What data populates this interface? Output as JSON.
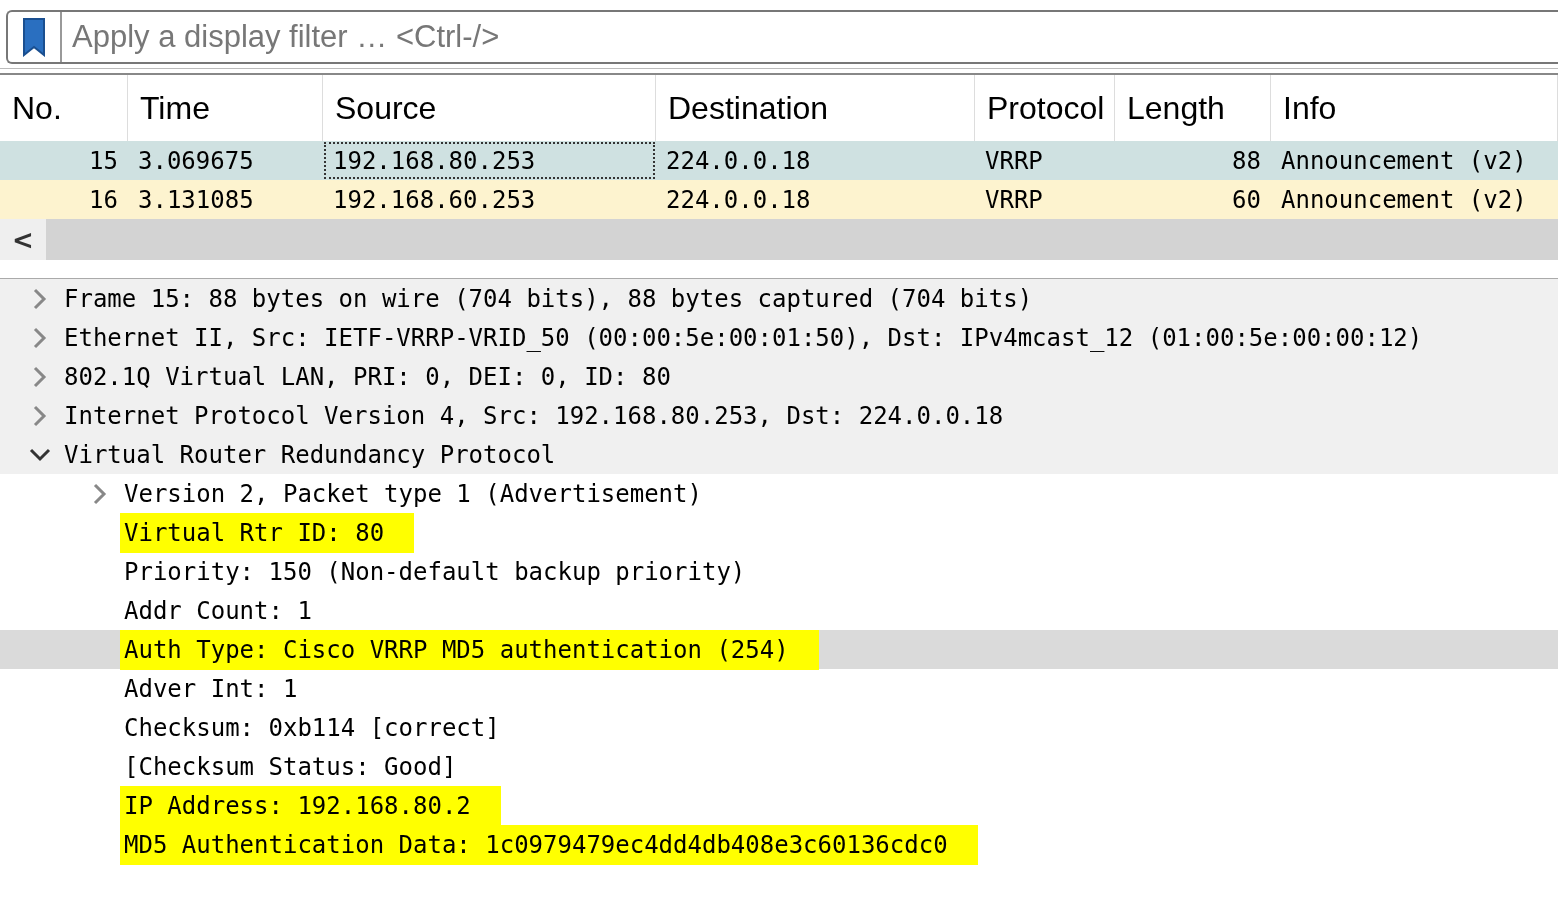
{
  "filter": {
    "placeholder": "Apply a display filter … <Ctrl-/>"
  },
  "packet_list": {
    "columns": [
      "No.",
      "Time",
      "Source",
      "Destination",
      "Protocol",
      "Length",
      "Info"
    ],
    "rows": [
      {
        "cells": [
          "15",
          "3.069675",
          "192.168.80.253",
          "224.0.0.18",
          "VRRP",
          "88",
          "Announcement (v2)"
        ],
        "selected": true
      },
      {
        "cells": [
          "16",
          "3.131085",
          "192.168.60.253",
          "224.0.0.18",
          "VRRP",
          "60",
          "Announcement (v2)"
        ],
        "selected": false
      }
    ],
    "scroll_left": "<"
  },
  "details": [
    {
      "text": "Frame 15: 88 bytes on wire (704 bits), 88 bytes captured (704 bits)",
      "kind": "branch",
      "expanded": false,
      "selected": false,
      "highlighted": false
    },
    {
      "text": "Ethernet II, Src: IETF-VRRP-VRID_50 (00:00:5e:00:01:50), Dst: IPv4mcast_12 (01:00:5e:00:00:12)",
      "kind": "branch",
      "expanded": false,
      "selected": false,
      "highlighted": false
    },
    {
      "text": "802.1Q Virtual LAN, PRI: 0, DEI: 0, ID: 80",
      "kind": "branch",
      "expanded": false,
      "selected": false,
      "highlighted": false
    },
    {
      "text": "Internet Protocol Version 4, Src: 192.168.80.253, Dst: 224.0.0.18",
      "kind": "branch",
      "expanded": false,
      "selected": false,
      "highlighted": false
    },
    {
      "text": "Virtual Router Redundancy Protocol",
      "kind": "branch",
      "expanded": true,
      "selected": false,
      "highlighted": false,
      "children": [
        {
          "text": "Version 2, Packet type 1 (Advertisement)",
          "kind": "branch",
          "expanded": false,
          "selected": false,
          "highlighted": false
        },
        {
          "text": "Virtual Rtr ID: 80",
          "kind": "leaf",
          "selected": false,
          "highlighted": true
        },
        {
          "text": "Priority: 150 (Non-default backup priority)",
          "kind": "leaf",
          "selected": false,
          "highlighted": false
        },
        {
          "text": "Addr Count: 1",
          "kind": "leaf",
          "selected": false,
          "highlighted": false
        },
        {
          "text": "Auth Type: Cisco VRRP MD5 authentication (254)",
          "kind": "leaf",
          "selected": true,
          "highlighted": true
        },
        {
          "text": "Adver Int: 1",
          "kind": "leaf",
          "selected": false,
          "highlighted": false
        },
        {
          "text": "Checksum: 0xb114 [correct]",
          "kind": "leaf",
          "selected": false,
          "highlighted": false
        },
        {
          "text": "[Checksum Status: Good]",
          "kind": "leaf",
          "selected": false,
          "highlighted": false
        },
        {
          "text": "IP Address: 192.168.80.2",
          "kind": "leaf",
          "selected": false,
          "highlighted": true
        },
        {
          "text": "MD5 Authentication Data: 1c0979479ec4dd4db408e3c60136cdc0",
          "kind": "leaf",
          "selected": false,
          "highlighted": true
        }
      ]
    }
  ]
}
